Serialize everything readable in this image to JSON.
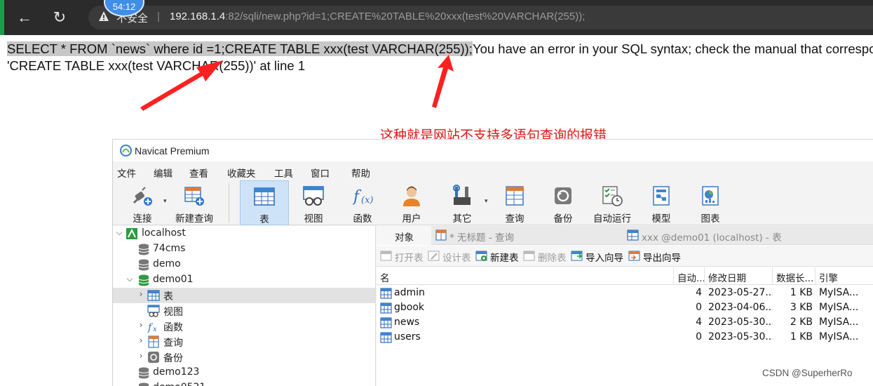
{
  "browser": {
    "timer": "54:12",
    "security_label": "不安全",
    "separator": "|",
    "url_host": "192.168.1.4",
    "url_path": ":82/sqli/new.php?id=1;CREATE%20TABLE%20xxx(test%20VARCHAR(255));"
  },
  "page": {
    "highlighted_sql": "SELECT * FROM `news` where id =1;CREATE TABLE xxx(test VARCHAR(255));",
    "error_tail": "You have an error in your SQL syntax; check the manual that correspo",
    "error_line2": "'CREATE TABLE xxx(test VARCHAR(255))' at line 1",
    "annotation": "这种就是网站不支持多语句查询的报错",
    "annotation_color": "#e01515"
  },
  "navicat": {
    "title": "Navicat Premium",
    "menu": [
      "文件",
      "编辑",
      "查看",
      "收藏夹",
      "工具",
      "窗口",
      "帮助"
    ],
    "toolbar": {
      "connect": "连接",
      "new_query": "新建查询",
      "table": "表",
      "view": "视图",
      "function": "函数",
      "user": "用户",
      "other": "其它",
      "query": "查询",
      "backup": "备份",
      "automation": "自动运行",
      "model": "模型",
      "chart": "图表"
    },
    "tree": {
      "connection": "localhost",
      "db_74cms": "74cms",
      "db_demo": "demo",
      "db_demo01": "demo01",
      "node_tables": "表",
      "node_views": "视图",
      "node_functions": "函数",
      "node_queries": "查询",
      "node_backups": "备份",
      "db_demo123": "demo123",
      "db_demo0521": "demo0521"
    },
    "tabs": {
      "objects": "对象",
      "untitled_query": "* 无标题 - 查询",
      "table_tab": "xxx @demo01 (localhost) - 表"
    },
    "object_toolbar": {
      "open_table": "打开表",
      "design_table": "设计表",
      "new_table": "新建表",
      "delete_table": "删除表",
      "import_wizard": "导入向导",
      "export_wizard": "导出向导"
    },
    "grid": {
      "columns": [
        "名",
        "自动...",
        "修改日期",
        "数据长...",
        "引擎"
      ],
      "rows": [
        {
          "name": "admin",
          "auto": "4",
          "modified": "2023-05-27...",
          "size": "1 KB",
          "engine": "MyISA..."
        },
        {
          "name": "gbook",
          "auto": "0",
          "modified": "2023-04-06...",
          "size": "3 KB",
          "engine": "MyISA..."
        },
        {
          "name": "news",
          "auto": "4",
          "modified": "2023-05-30...",
          "size": "2 KB",
          "engine": "MyISA..."
        },
        {
          "name": "users",
          "auto": "0",
          "modified": "2023-05-30...",
          "size": "1 KB",
          "engine": "MyISA..."
        }
      ]
    }
  },
  "watermark": "CSDN @SuperherRo"
}
